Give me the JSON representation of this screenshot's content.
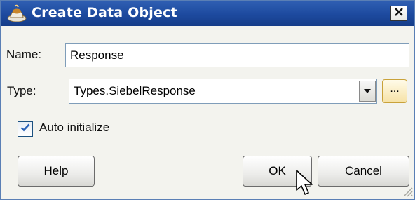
{
  "window": {
    "title": "Create Data Object",
    "close_symbol": "✕"
  },
  "form": {
    "name_label": "Name:",
    "name_value": "Response",
    "type_label": "Type:",
    "type_value": "Types.SiebelResponse",
    "browse_label": "...",
    "auto_initialize_label": "Auto initialize",
    "auto_initialize_checked": true
  },
  "buttons": {
    "help": "Help",
    "ok": "OK",
    "cancel": "Cancel"
  },
  "icons": {
    "title": "cup-bean-icon",
    "close": "close-icon",
    "dropdown": "chevron-down-icon",
    "check": "check-icon",
    "cursor": "pointer-cursor-icon",
    "resize": "resize-grip-icon"
  },
  "colors": {
    "titlebar": "#1d4a9f",
    "dialog_bg": "#f3f3ee",
    "browse_accent": "#f6e2a6",
    "check": "#2a62b8"
  }
}
